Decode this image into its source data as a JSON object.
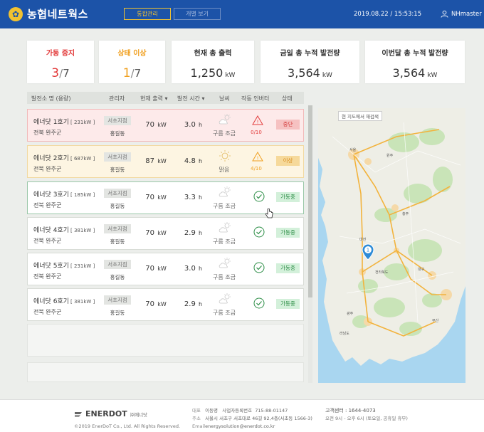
{
  "header": {
    "logo_text": "농협네트웍스",
    "tab_active": "통합관리",
    "tab_inactive": "개별 보기",
    "datetime": "2019.08.22 / 15:53:15",
    "user": "NHmaster"
  },
  "summary": {
    "stopped": {
      "title": "가동 중지",
      "count": "3",
      "total": "7"
    },
    "abnormal": {
      "title": "상태 이상",
      "count": "1",
      "total": "7"
    },
    "output": {
      "title": "현재 총 출력",
      "value": "1,250",
      "unit": "kW"
    },
    "today": {
      "title": "금일 총 누적 발전량",
      "value": "3,564",
      "unit": "kW"
    },
    "month": {
      "title": "이번달 총 누적 발전량",
      "value": "3,564",
      "unit": "kW"
    }
  },
  "table": {
    "headers": {
      "name": "발전소 명 (용량)",
      "manager": "관리자",
      "output": "현재 출력 ▾",
      "time": "발전 시간 ▾",
      "weather": "날씨",
      "inverter": "작동 인버터",
      "status": "상태"
    },
    "rows": [
      {
        "name": "에너닷 1호기",
        "cap": "[ 231kW ]",
        "loc": "전북 완주군",
        "branch": "서초지점",
        "mgr": "홍길동",
        "output": "70",
        "output_unit": "kW",
        "time": "3.0",
        "time_unit": "h",
        "weather": "구름 조금",
        "weather_icon": "cloud-sun",
        "inverter": "0/10",
        "inverter_state": "alert",
        "status": "중단",
        "state": "stop"
      },
      {
        "name": "에너닷 2호기",
        "cap": "[ 687kW ]",
        "loc": "전북 완주군",
        "branch": "서초지점",
        "mgr": "홍길동",
        "output": "87",
        "output_unit": "kW",
        "time": "4.8",
        "time_unit": "h",
        "weather": "맑음",
        "weather_icon": "sun",
        "inverter": "4/10",
        "inverter_state": "warning",
        "status": "이상",
        "state": "warn"
      },
      {
        "name": "에너닷 3호기",
        "cap": "[ 185kW ]",
        "loc": "전북 완주군",
        "branch": "서초지점",
        "mgr": "홍길동",
        "output": "70",
        "output_unit": "kW",
        "time": "3.3",
        "time_unit": "h",
        "weather": "구름 조금",
        "weather_icon": "cloud-sun",
        "inverter": "",
        "inverter_state": "ok",
        "status": "가동중",
        "state": "run"
      },
      {
        "name": "에너닷 4호기",
        "cap": "[ 381kW ]",
        "loc": "전북 완주군",
        "branch": "서초지점",
        "mgr": "홍길동",
        "output": "70",
        "output_unit": "kW",
        "time": "2.9",
        "time_unit": "h",
        "weather": "구름 조금",
        "weather_icon": "cloud-sun",
        "inverter": "",
        "inverter_state": "ok",
        "status": "가동중",
        "state": "run"
      },
      {
        "name": "에너닷 5호기",
        "cap": "[ 231kW ]",
        "loc": "전북 완주군",
        "branch": "서초지점",
        "mgr": "홍길동",
        "output": "70",
        "output_unit": "kW",
        "time": "3.0",
        "time_unit": "h",
        "weather": "구름 조금",
        "weather_icon": "cloud-sun",
        "inverter": "",
        "inverter_state": "ok",
        "status": "가동중",
        "state": "run"
      },
      {
        "name": "에너닷 6호기",
        "cap": "[ 381kW ]",
        "loc": "전북 완주군",
        "branch": "서초지점",
        "mgr": "홍길동",
        "output": "70",
        "output_unit": "kW",
        "time": "2.9",
        "time_unit": "h",
        "weather": "구름 조금",
        "weather_icon": "cloud-sun",
        "inverter": "",
        "inverter_state": "ok",
        "status": "가동중",
        "state": "run"
      }
    ]
  },
  "map": {
    "chip": "현 지도에서 재검색",
    "marker_label": "1"
  },
  "footer": {
    "brand": "ENERDOT",
    "brand_sub": "㈜에너닷",
    "copyright": "©2019 EnerDoT Co., Ltd. All Rights Reserved.",
    "ceo_label": "대표",
    "ceo": "이동명",
    "biz_label": "사업자등록번호",
    "biz_no": "715-88-01147",
    "addr_label": "주소",
    "address": "서울시 서초구 서초대로 46길 92,4층(서초동 1566-3)",
    "email_label": "Email",
    "email": "energysolution@enerdot.co.kr",
    "cs": "고객센터 : 1644-4073",
    "hours": "오전 9시 - 오후 6시 (토요일, 공휴일 휴무)"
  },
  "colors": {
    "header": "#1c53a8",
    "stop": "#e23a3a",
    "warn": "#f0a020",
    "run": "#2d8e47"
  }
}
